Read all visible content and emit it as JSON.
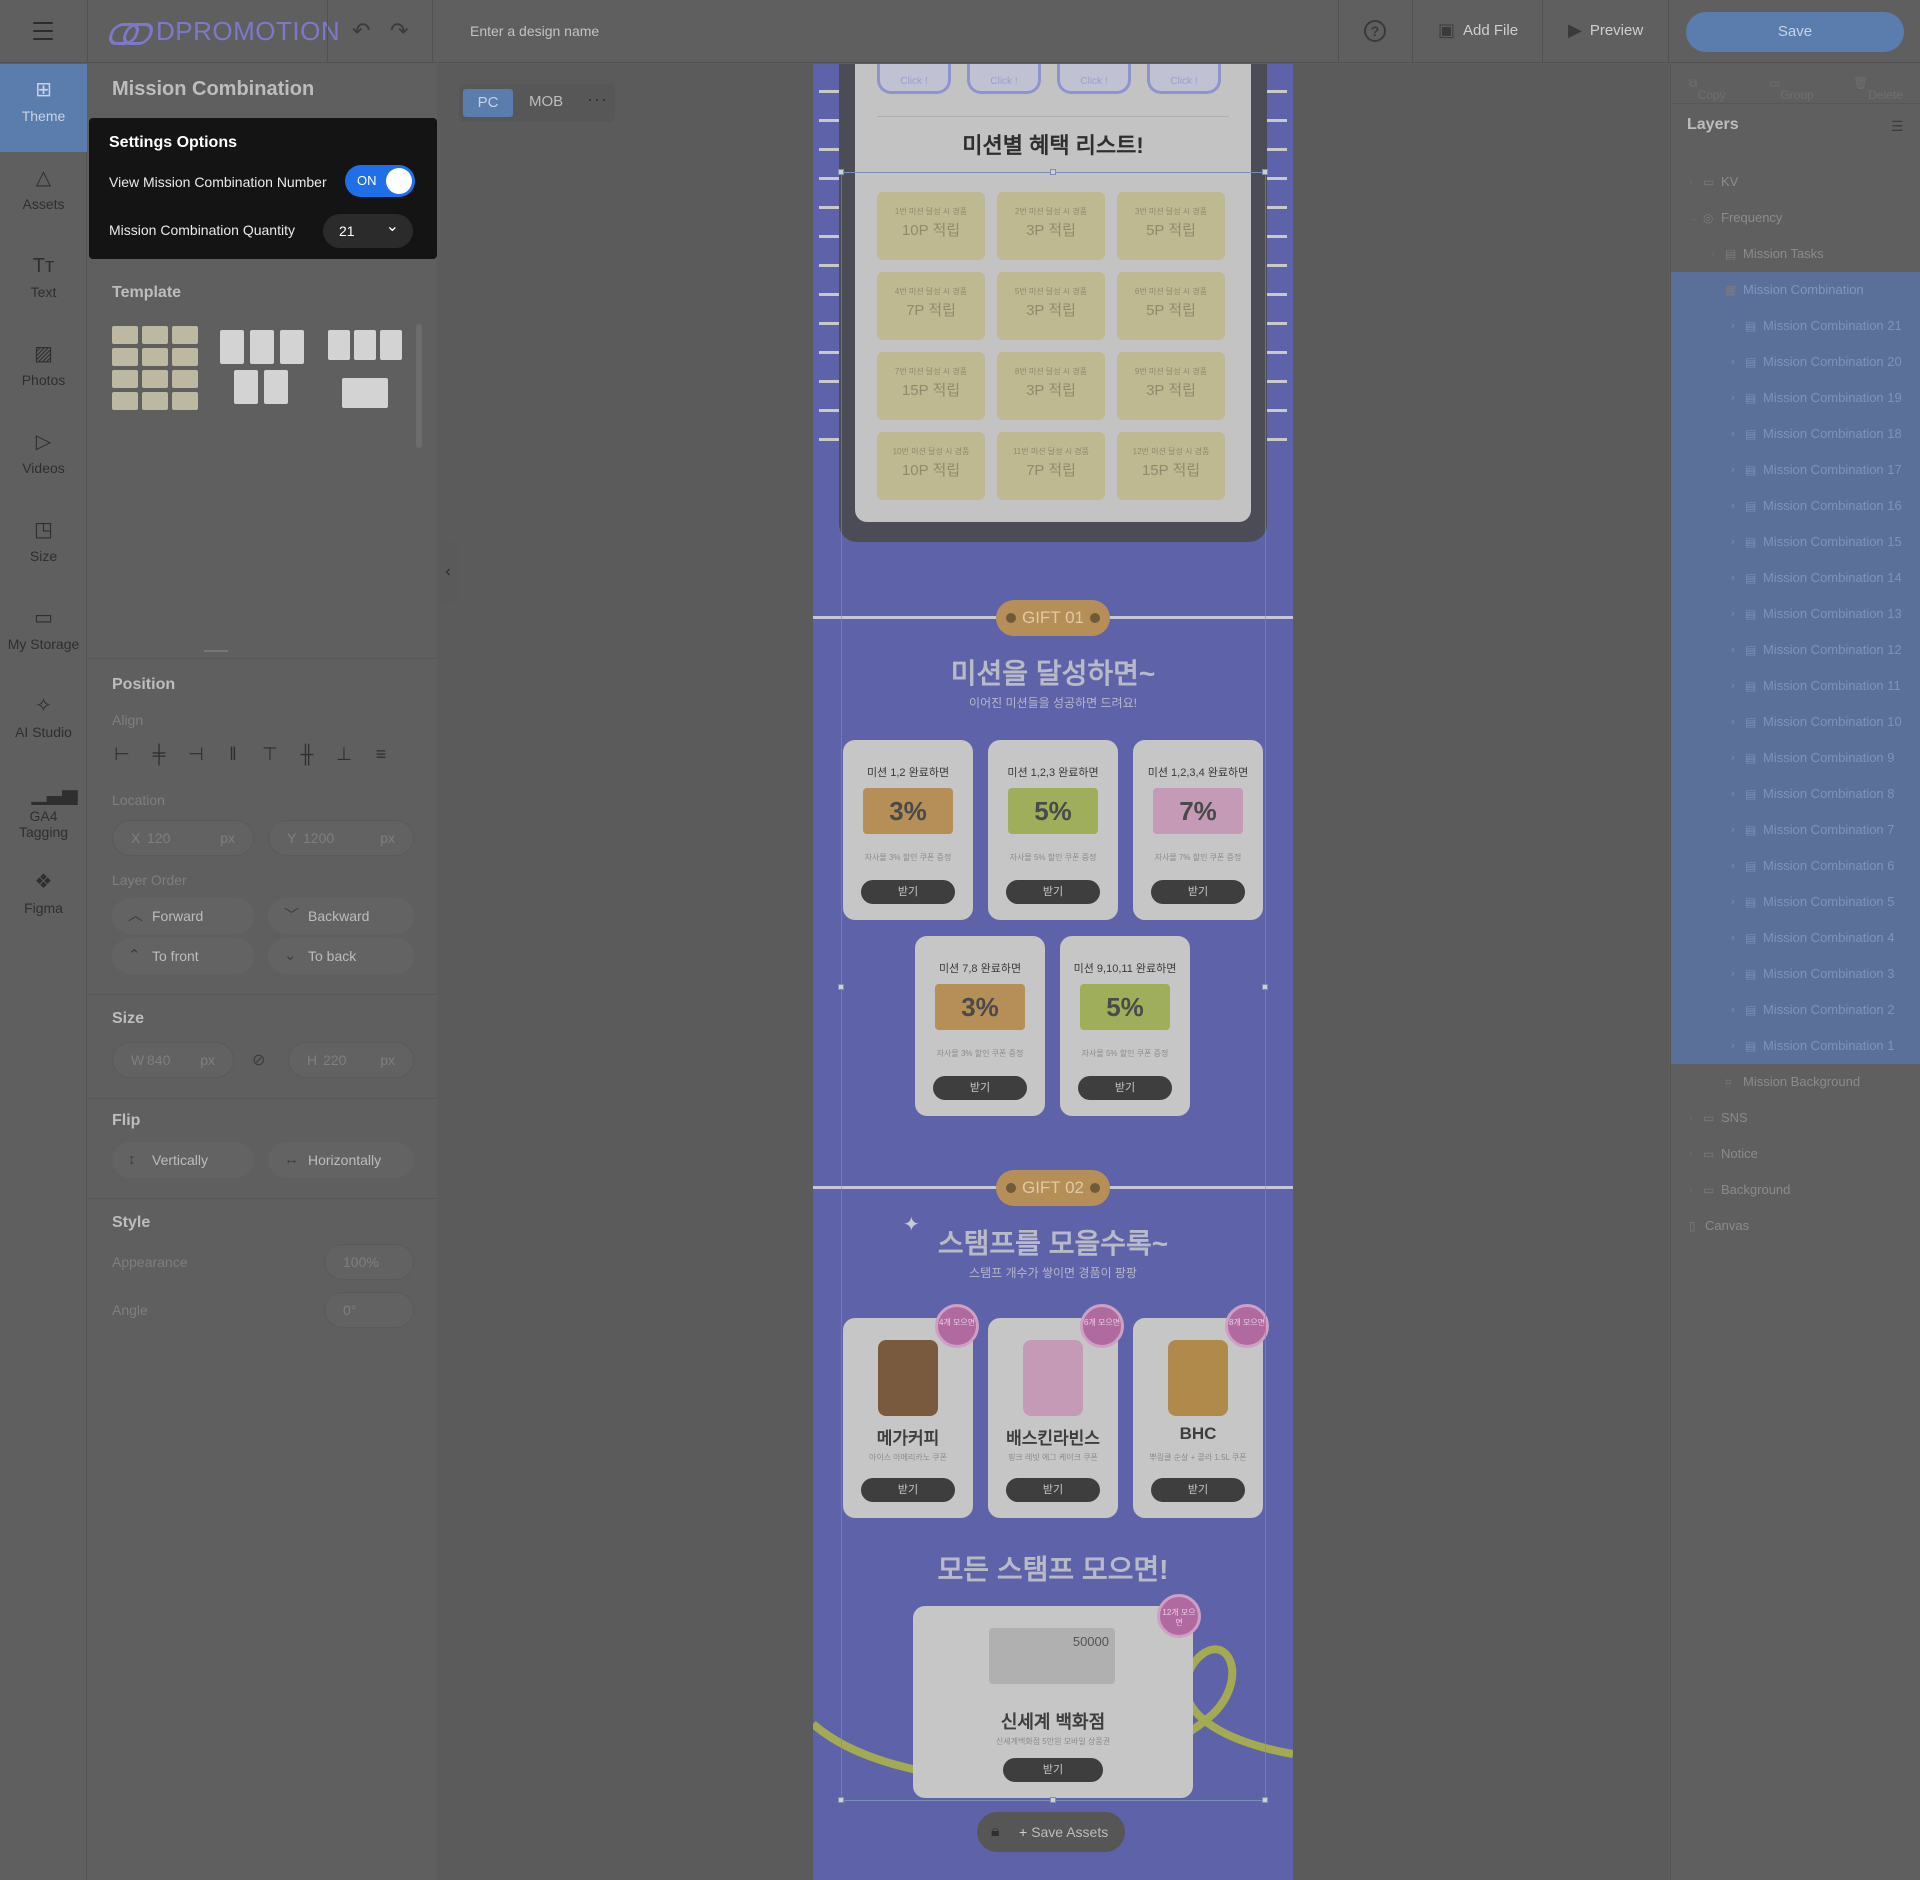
{
  "topbar": {
    "logo": "DPROMOTION",
    "design_name_placeholder": "Enter a design name",
    "add_file": "Add File",
    "preview": "Preview",
    "save": "Save"
  },
  "rail": [
    {
      "label": "Theme",
      "icon": "theme-icon"
    },
    {
      "label": "Assets",
      "icon": "assets-icon"
    },
    {
      "label": "Text",
      "icon": "text-icon"
    },
    {
      "label": "Photos",
      "icon": "photos-icon"
    },
    {
      "label": "Videos",
      "icon": "videos-icon"
    },
    {
      "label": "Size",
      "icon": "size-icon"
    },
    {
      "label": "My Storage",
      "icon": "folder-icon"
    },
    {
      "label": "AI Studio",
      "icon": "magic-wand-icon"
    },
    {
      "label": "GA4 Tagging",
      "icon": "chart-icon"
    },
    {
      "label": "Figma",
      "icon": "figma-icon"
    }
  ],
  "panel": {
    "title": "Mission Combination",
    "settings": {
      "title": "Settings Options",
      "view_number_label": "View Mission Combination Number",
      "toggle_state": "ON",
      "quantity_label": "Mission Combination Quantity",
      "quantity_value": "21"
    },
    "template_title": "Template",
    "position": {
      "title": "Position",
      "align_label": "Align",
      "location_label": "Location",
      "x_label": "X",
      "x_value": "120",
      "x_unit": "px",
      "y_label": "Y",
      "y_value": "1200",
      "y_unit": "px",
      "layer_order_label": "Layer Order",
      "forward": "Forward",
      "backward": "Backward",
      "to_front": "To front",
      "to_back": "To back"
    },
    "size": {
      "title": "Size",
      "w_label": "W",
      "w_value": "840",
      "w_unit": "px",
      "h_label": "H",
      "h_value": "220",
      "h_unit": "px"
    },
    "flip": {
      "title": "Flip",
      "vertically": "Vertically",
      "horizontally": "Horizontally"
    },
    "style": {
      "title": "Style",
      "appearance_label": "Appearance",
      "appearance_value": "100%",
      "angle_label": "Angle",
      "angle_value": "0°"
    }
  },
  "device_tabs": {
    "pc": "PC",
    "mob": "MOB",
    "more": "···"
  },
  "design": {
    "click_label": "Click !",
    "list_title": "미션별 혜택 리스트!",
    "tickets": [
      {
        "sub": "1번 미션 달성 시 경품",
        "reward": "10P 적립"
      },
      {
        "sub": "2번 미션 달성 시 경품",
        "reward": "3P 적립"
      },
      {
        "sub": "3번 미션 달성 시 경품",
        "reward": "5P 적립"
      },
      {
        "sub": "4번 미션 달성 시 경품",
        "reward": "7P 적립"
      },
      {
        "sub": "5번 미션 달성 시 경품",
        "reward": "3P 적립"
      },
      {
        "sub": "6번 미션 달성 시 경품",
        "reward": "5P 적립"
      },
      {
        "sub": "7번 미션 달성 시 경품",
        "reward": "15P 적립"
      },
      {
        "sub": "8번 미션 달성 시 경품",
        "reward": "3P 적립"
      },
      {
        "sub": "9번 미션 달성 시 경품",
        "reward": "3P 적립"
      },
      {
        "sub": "10번 미션 달성 시 경품",
        "reward": "10P 적립"
      },
      {
        "sub": "11번 미션 달성 시 경품",
        "reward": "7P 적립"
      },
      {
        "sub": "12번 미션 달성 시 경품",
        "reward": "15P 적립"
      }
    ],
    "gift1": {
      "label": "GIFT 01",
      "title": "미션을 달성하면~",
      "subtitle": "이어진 미션들을 성공하면 드려요!",
      "cards": [
        {
          "title": "미션 1,2 완료하면",
          "coupon": "3%",
          "desc": "자사몰 3% 할인 쿠폰 증정",
          "button": "받기",
          "color": "#b68e57"
        },
        {
          "title": "미션 1,2,3 완료하면",
          "coupon": "5%",
          "desc": "자사몰 5% 할인 쿠폰 증정",
          "button": "받기",
          "color": "#9fae5a"
        },
        {
          "title": "미션 1,2,3,4 완료하면",
          "coupon": "7%",
          "desc": "자사몰 7% 할인 쿠폰 증정",
          "button": "받기",
          "color": "#c59ab7"
        },
        {
          "title": "미션 7,8 완료하면",
          "coupon": "3%",
          "desc": "자사몰 3% 할인 쿠폰 증정",
          "button": "받기",
          "color": "#b68e57"
        },
        {
          "title": "미션 9,10,11 완료하면",
          "coupon": "5%",
          "desc": "자사몰 5% 할인 쿠폰 증정",
          "button": "받기",
          "color": "#9fae5a"
        }
      ]
    },
    "gift2": {
      "label": "GIFT 02",
      "title": "스탬프를 모을수록~",
      "subtitle": "스탬프 개수가 쌓이면 경품이 팡팡",
      "cards": [
        {
          "name": "메가커피",
          "desc": "아이스 아메리카노 쿠폰",
          "button": "받기",
          "badge": "4개 모으면"
        },
        {
          "name": "배스킨라빈스",
          "desc": "핑크 레빗 에그 케이크 쿠폰",
          "button": "받기",
          "badge": "6개 모으면"
        },
        {
          "name": "BHC",
          "desc": "뿌링클 순살 + 콜라 1.5L 쿠폰",
          "button": "받기",
          "badge": "8개 모으면"
        }
      ],
      "all_title": "모든 스탬프 모으면!",
      "big": {
        "name": "신세계 백화점",
        "desc": "신세계백화점 5만원 모바일 상품권",
        "button": "받기",
        "amount": "50000",
        "badge": "12개 모으면"
      }
    },
    "save_assets": "Save Assets"
  },
  "rpanel": {
    "copy": "Copy",
    "group": "Group",
    "delete": "Delete",
    "layers_title": "Layers",
    "layers": [
      {
        "name": "KV",
        "indent": 0,
        "chev": "›",
        "icon": "folder-icon"
      },
      {
        "name": "Frequency",
        "indent": 0,
        "chev": "⌄",
        "icon": "globe-icon"
      },
      {
        "name": "Mission Tasks",
        "indent": 1,
        "chev": "›",
        "icon": "list-icon"
      },
      {
        "name": "Mission Combination",
        "indent": 1,
        "chev": "⌄",
        "icon": "stack-icon",
        "selected": true
      },
      {
        "name": "Mission Combination 21",
        "indent": 2,
        "chev": "›",
        "icon": "list-icon",
        "child": true
      },
      {
        "name": "Mission Combination 20",
        "indent": 2,
        "chev": "›",
        "icon": "list-icon",
        "child": true
      },
      {
        "name": "Mission Combination 19",
        "indent": 2,
        "chev": "›",
        "icon": "list-icon",
        "child": true
      },
      {
        "name": "Mission Combination 18",
        "indent": 2,
        "chev": "›",
        "icon": "list-icon",
        "child": true
      },
      {
        "name": "Mission Combination 17",
        "indent": 2,
        "chev": "›",
        "icon": "list-icon",
        "child": true
      },
      {
        "name": "Mission Combination 16",
        "indent": 2,
        "chev": "›",
        "icon": "list-icon",
        "child": true
      },
      {
        "name": "Mission Combination 15",
        "indent": 2,
        "chev": "›",
        "icon": "list-icon",
        "child": true
      },
      {
        "name": "Mission Combination 14",
        "indent": 2,
        "chev": "›",
        "icon": "list-icon",
        "child": true
      },
      {
        "name": "Mission Combination 13",
        "indent": 2,
        "chev": "›",
        "icon": "list-icon",
        "child": true
      },
      {
        "name": "Mission Combination 12",
        "indent": 2,
        "chev": "›",
        "icon": "list-icon",
        "child": true
      },
      {
        "name": "Mission Combination 11",
        "indent": 2,
        "chev": "›",
        "icon": "list-icon",
        "child": true
      },
      {
        "name": "Mission Combination 10",
        "indent": 2,
        "chev": "›",
        "icon": "list-icon",
        "child": true
      },
      {
        "name": "Mission Combination 9",
        "indent": 2,
        "chev": "›",
        "icon": "list-icon",
        "child": true
      },
      {
        "name": "Mission Combination 8",
        "indent": 2,
        "chev": "›",
        "icon": "list-icon",
        "child": true
      },
      {
        "name": "Mission Combination 7",
        "indent": 2,
        "chev": "›",
        "icon": "list-icon",
        "child": true
      },
      {
        "name": "Mission Combination 6",
        "indent": 2,
        "chev": "›",
        "icon": "list-icon",
        "child": true
      },
      {
        "name": "Mission Combination 5",
        "indent": 2,
        "chev": "›",
        "icon": "list-icon",
        "child": true
      },
      {
        "name": "Mission Combination 4",
        "indent": 2,
        "chev": "›",
        "icon": "list-icon",
        "child": true
      },
      {
        "name": "Mission Combination 3",
        "indent": 2,
        "chev": "›",
        "icon": "list-icon",
        "child": true
      },
      {
        "name": "Mission Combination 2",
        "indent": 2,
        "chev": "›",
        "icon": "list-icon",
        "child": true
      },
      {
        "name": "Mission Combination 1",
        "indent": 2,
        "chev": "›",
        "icon": "list-icon",
        "child": true
      },
      {
        "name": "Mission Background",
        "indent": 1,
        "chev": "",
        "icon": "frame-icon"
      },
      {
        "name": "SNS",
        "indent": 0,
        "chev": "›",
        "icon": "folder-icon"
      },
      {
        "name": "Notice",
        "indent": 0,
        "chev": "›",
        "icon": "folder-icon"
      },
      {
        "name": "Background",
        "indent": 0,
        "chev": "›",
        "icon": "folder-icon"
      },
      {
        "name": "Canvas",
        "indent": -1,
        "chev": "",
        "icon": "page-icon"
      }
    ]
  }
}
